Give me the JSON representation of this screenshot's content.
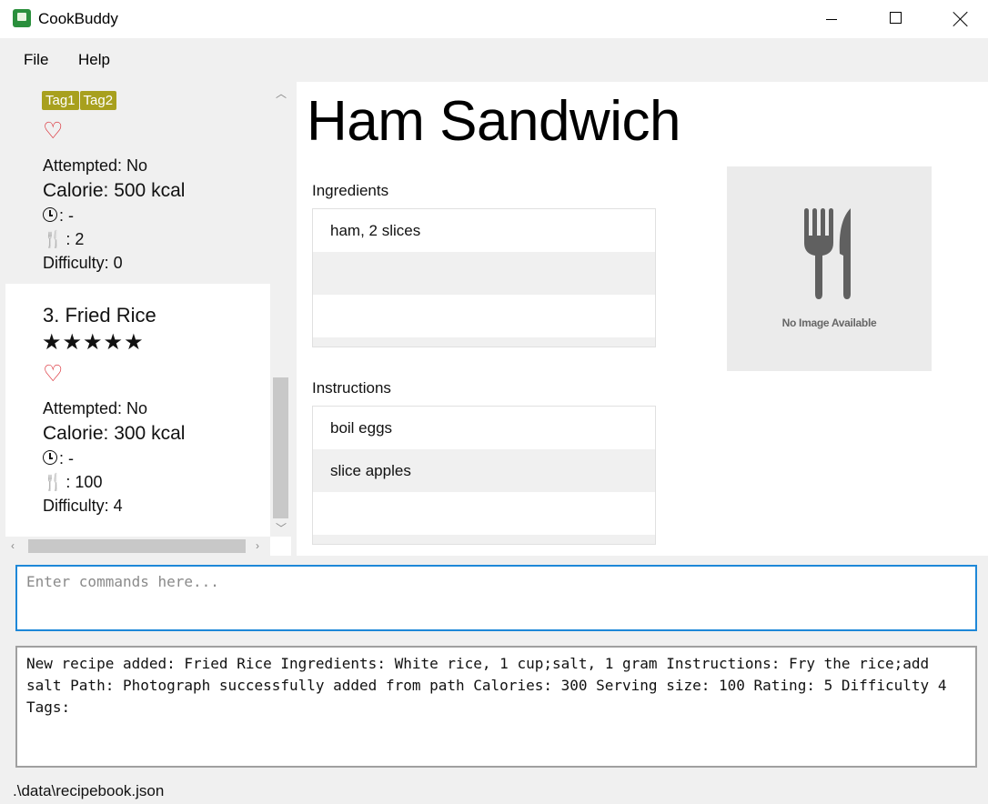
{
  "window": {
    "title": "CookBuddy"
  },
  "menu": {
    "file": "File",
    "help": "Help"
  },
  "recipe_list": [
    {
      "stars_partial": "☆☆☆☆☆",
      "tags": [
        "Tag1",
        "Tag2"
      ],
      "favourite": "♡",
      "attempted": "Attempted: No",
      "calorie": "Calorie: 500 kcal",
      "time": ": -",
      "serving": ": 2",
      "difficulty": "Difficulty: 0"
    },
    {
      "index_name": "3.  Fried Rice",
      "stars": "★★★★★",
      "favourite": "♡",
      "attempted": "Attempted: No",
      "calorie": "Calorie: 300 kcal",
      "time": ": -",
      "serving": ": 100",
      "difficulty": "Difficulty: 4"
    }
  ],
  "detail": {
    "title": "Ham Sandwich",
    "ingredients_label": "Ingredients",
    "ingredients": [
      "ham, 2 slices",
      "",
      ""
    ],
    "instructions_label": "Instructions",
    "instructions": [
      "boil eggs",
      "slice apples",
      ""
    ],
    "image_caption": "No Image Available"
  },
  "command": {
    "placeholder": "Enter commands here...",
    "value": ""
  },
  "result": {
    "text": "New recipe added: Fried Rice Ingredients: White rice, 1 cup;salt, 1 gram Instructions: Fry the rice;add salt Path: Photograph successfully added from path Calories: 300 Serving size: 100 Rating: 5 Difficulty 4 Tags:"
  },
  "status": {
    "path": ".\\data\\recipebook.json"
  },
  "colors": {
    "accent": "#1e88d8",
    "tag": "#a8a01e",
    "heart": "#d9222a"
  },
  "icons": [
    "app-icon",
    "heart-icon",
    "clock-icon",
    "utensils-icon",
    "fork-knife-icon"
  ]
}
